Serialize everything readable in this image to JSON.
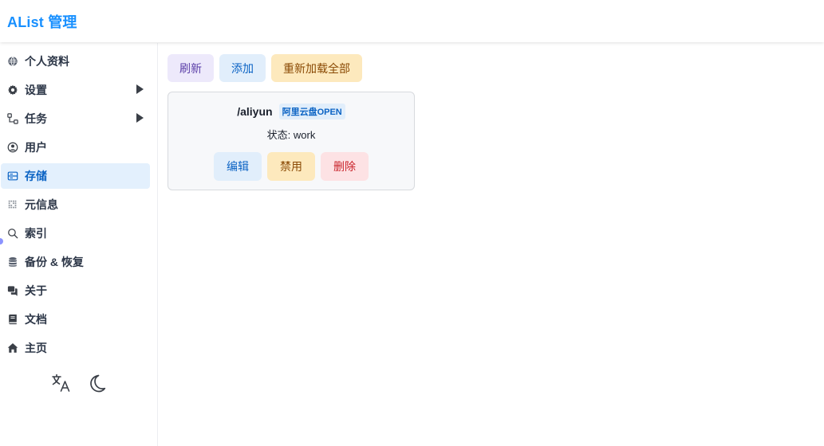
{
  "header": {
    "title": "AList 管理"
  },
  "sidebar": {
    "items": [
      {
        "label": "个人资料",
        "icon": "user-profile-icon",
        "active": false
      },
      {
        "label": "设置",
        "icon": "gear-icon",
        "active": false,
        "expandable": true
      },
      {
        "label": "任务",
        "icon": "task-flow-icon",
        "active": false,
        "expandable": true
      },
      {
        "label": "用户",
        "icon": "user-circle-icon",
        "active": false
      },
      {
        "label": "存储",
        "icon": "storage-icon",
        "active": true
      },
      {
        "label": "元信息",
        "icon": "metainfo-icon",
        "active": false
      },
      {
        "label": "索引",
        "icon": "search-icon",
        "active": false
      },
      {
        "label": "备份 & 恢复",
        "icon": "database-icon",
        "active": false
      },
      {
        "label": "关于",
        "icon": "chat-bubbles-icon",
        "active": false
      },
      {
        "label": "文档",
        "icon": "book-icon",
        "active": false
      },
      {
        "label": "主页",
        "icon": "home-icon",
        "active": false
      }
    ],
    "footer": {
      "language_icon": "translate-icon",
      "theme_icon": "moon-icon"
    }
  },
  "toolbar": {
    "refresh_label": "刷新",
    "add_label": "添加",
    "reload_all_label": "重新加载全部"
  },
  "storage_card": {
    "mount_path": "/aliyun",
    "driver": "阿里云盘OPEN",
    "status": "状态: work",
    "edit_label": "编辑",
    "disable_label": "禁用",
    "delete_label": "删除"
  },
  "colors": {
    "brand": "#1890ff",
    "active_bg": "#e3f0fd",
    "active_text": "#0b63c4",
    "purple_btn": "#ede9fb",
    "blue_btn": "#e1eefb",
    "yellow_btn": "#fde9bd",
    "red_btn": "#fde2e4"
  }
}
